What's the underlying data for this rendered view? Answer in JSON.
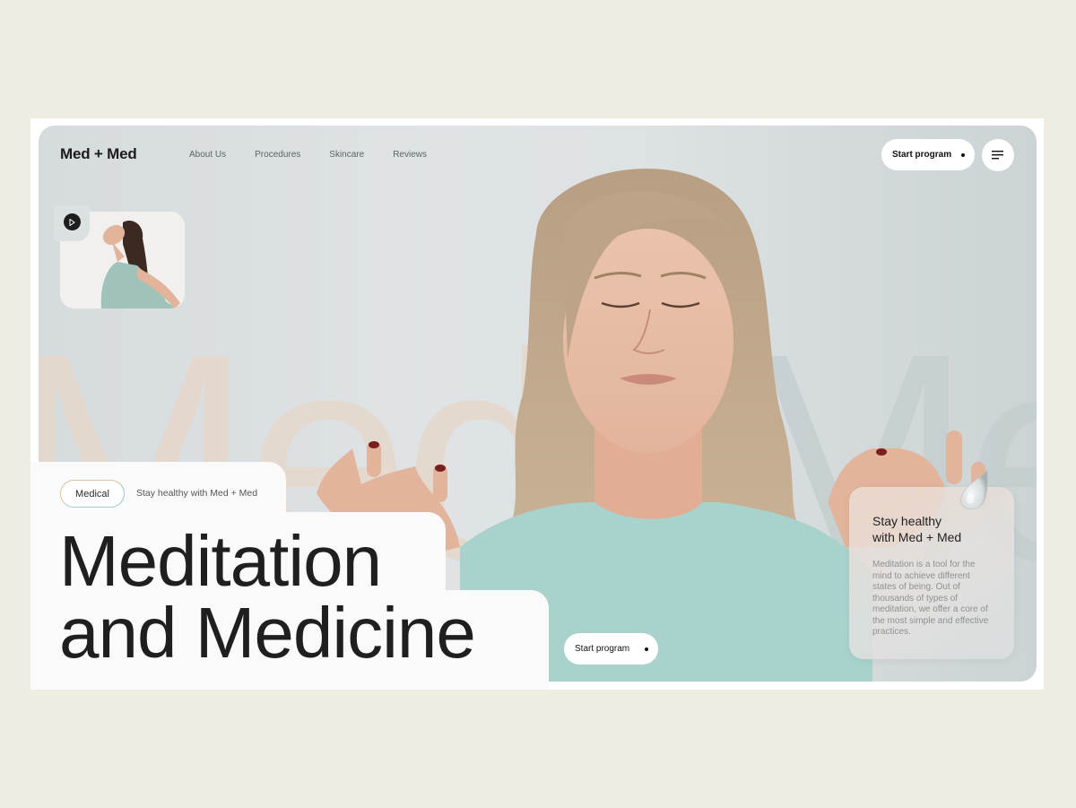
{
  "brand": {
    "logo": "Med + Med"
  },
  "nav": {
    "items": [
      "About Us",
      "Procedures",
      "Skincare",
      "Reviews"
    ]
  },
  "header": {
    "start_program_label": "Start program"
  },
  "background_text": {
    "left": "Med+",
    "right": "Med"
  },
  "hero": {
    "tag": "Medical",
    "tagline": "Stay healthy with Med + Med",
    "headline_line1": "Meditation",
    "headline_line2": "and Medicine",
    "cta_label": "Start program"
  },
  "card": {
    "title": "Stay healthy\nwith Med + Med",
    "body": "Meditation is a tool for the mind to achieve different states of being. Out of thousands of types of meditation, we offer a core of the most simple and effective practices."
  },
  "icons": {
    "menu": "menu-icon",
    "play": "play-icon",
    "drop": "water-drop-icon"
  },
  "colors": {
    "page_background": "#efece1",
    "accent_peach": "#e6d8cc",
    "sweater_mint": "#a9d2cd",
    "text_dark": "#1f1f1f"
  }
}
